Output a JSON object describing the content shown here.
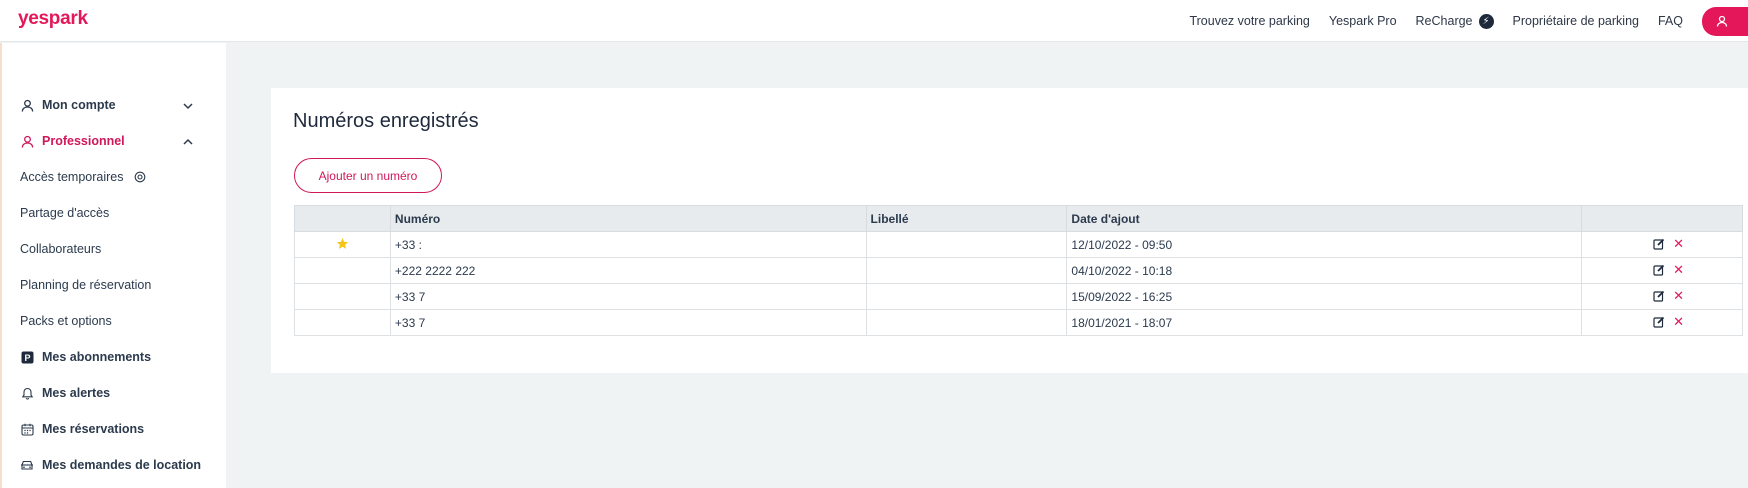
{
  "brand": {
    "logo": "yespark",
    "accent": "#e3175a",
    "dark": "#1e2a3b"
  },
  "header": {
    "nav": [
      "Trouvez votre parking",
      "Yespark Pro",
      "ReCharge",
      "Propriétaire de parking",
      "FAQ"
    ]
  },
  "sidebar": {
    "items": [
      {
        "label": "Mon compte",
        "icon": "user-icon",
        "expanded": false
      },
      {
        "label": "Professionnel",
        "icon": "user-icon",
        "expanded": true
      },
      {
        "label": "Accès temporaires",
        "icon": "target-icon"
      },
      {
        "label": "Partage d'accès"
      },
      {
        "label": "Collaborateurs"
      },
      {
        "label": "Planning de réservation"
      },
      {
        "label": "Packs et options"
      },
      {
        "label": "Mes abonnements",
        "icon": "parking-icon"
      },
      {
        "label": "Mes alertes",
        "icon": "bell-icon"
      },
      {
        "label": "Mes réservations",
        "icon": "calendar-icon"
      },
      {
        "label": "Mes demandes de location",
        "icon": "car-icon"
      }
    ]
  },
  "main": {
    "title": "Numéros enregistrés",
    "add_button": "Ajouter un numéro",
    "table": {
      "headers": [
        "",
        "Numéro",
        "Libellé",
        "Date d'ajout",
        ""
      ],
      "rows": [
        {
          "favorite": true,
          "numero": "+33 :",
          "libelle": "",
          "date": "12/10/2022 - 09:50"
        },
        {
          "favorite": false,
          "numero": "+222 2222 222",
          "libelle": "",
          "date": "04/10/2022 - 10:18"
        },
        {
          "favorite": false,
          "numero": "+33 7",
          "libelle": "",
          "date": "15/09/2022 - 16:25"
        },
        {
          "favorite": false,
          "numero": "+33 7",
          "libelle": "",
          "date": "18/01/2021 - 18:07"
        }
      ]
    }
  }
}
